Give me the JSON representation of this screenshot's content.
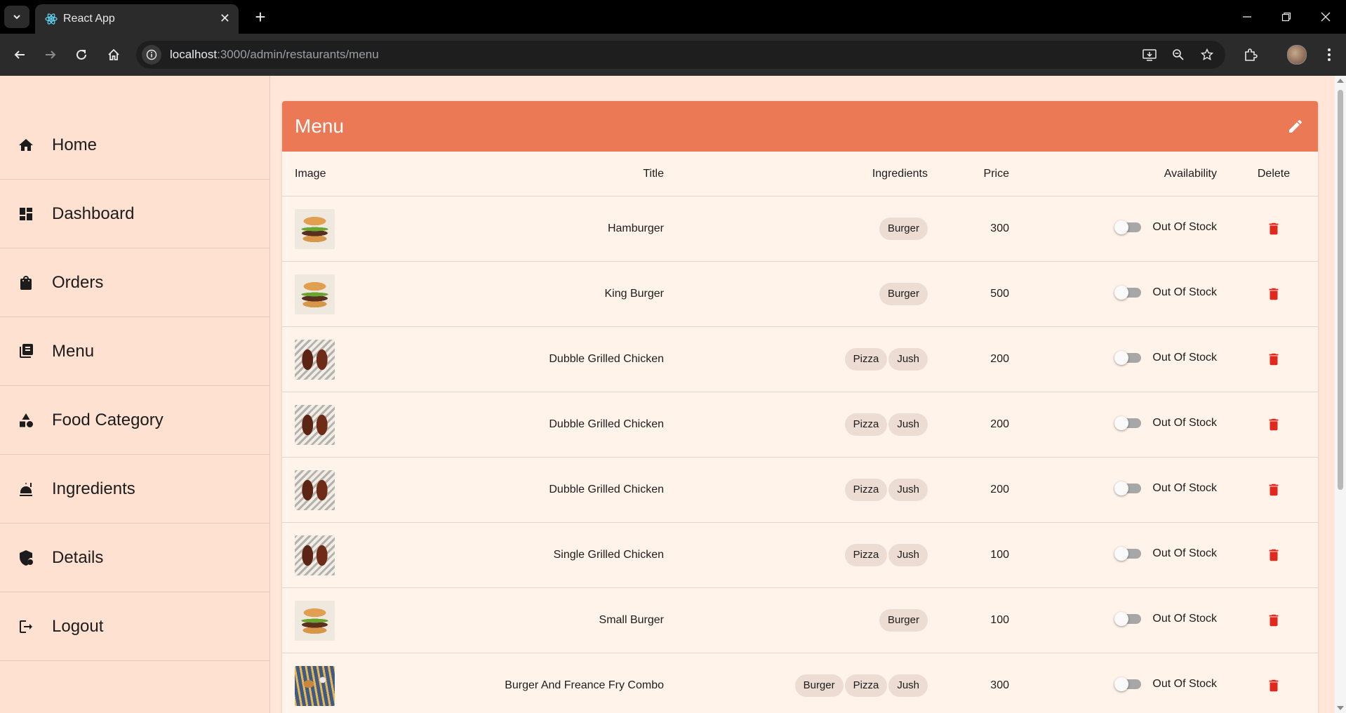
{
  "browser": {
    "tab_title": "React App",
    "url_host": "localhost",
    "url_path": ":3000/admin/restaurants/menu"
  },
  "sidebar": {
    "items": [
      {
        "label": "Home",
        "icon": "home-icon"
      },
      {
        "label": "Dashboard",
        "icon": "dashboard-icon"
      },
      {
        "label": "Orders",
        "icon": "shopping-bag-icon"
      },
      {
        "label": "Menu",
        "icon": "menu-book-icon"
      },
      {
        "label": "Food Category",
        "icon": "category-icon"
      },
      {
        "label": "Ingredients",
        "icon": "food-bank-icon"
      },
      {
        "label": "Details",
        "icon": "admin-panel-icon"
      },
      {
        "label": "Logout",
        "icon": "logout-icon"
      }
    ]
  },
  "menu": {
    "title": "Menu",
    "columns": {
      "image": "Image",
      "title": "Title",
      "ingredients": "Ingredients",
      "price": "Price",
      "availability": "Availability",
      "delete": "Delete"
    },
    "rows": [
      {
        "image": "burger",
        "title": "Hamburger",
        "ingredients": [
          "Burger"
        ],
        "price": "300",
        "availability": "Out Of Stock"
      },
      {
        "image": "burger",
        "title": "King Burger",
        "ingredients": [
          "Burger"
        ],
        "price": "500",
        "availability": "Out Of Stock"
      },
      {
        "image": "chicken",
        "title": "Dubble Grilled Chicken",
        "ingredients": [
          "Pizza",
          "Jush"
        ],
        "price": "200",
        "availability": "Out Of Stock"
      },
      {
        "image": "chicken",
        "title": "Dubble Grilled Chicken",
        "ingredients": [
          "Pizza",
          "Jush"
        ],
        "price": "200",
        "availability": "Out Of Stock"
      },
      {
        "image": "chicken",
        "title": "Dubble Grilled Chicken",
        "ingredients": [
          "Pizza",
          "Jush"
        ],
        "price": "200",
        "availability": "Out Of Stock"
      },
      {
        "image": "chicken",
        "title": "Single Grilled Chicken",
        "ingredients": [
          "Pizza",
          "Jush"
        ],
        "price": "100",
        "availability": "Out Of Stock"
      },
      {
        "image": "burger",
        "title": "Small Burger",
        "ingredients": [
          "Burger"
        ],
        "price": "100",
        "availability": "Out Of Stock"
      },
      {
        "image": "combo",
        "title": "Burger And Freance Fry Combo",
        "ingredients": [
          "Burger",
          "Pizza",
          "Jush"
        ],
        "price": "300",
        "availability": "Out Of Stock"
      }
    ]
  },
  "colors": {
    "header": "#ec7955",
    "delete": "#e0281e",
    "sidebar_bg": "#ffe1d2",
    "card_bg": "#fff3ea"
  }
}
